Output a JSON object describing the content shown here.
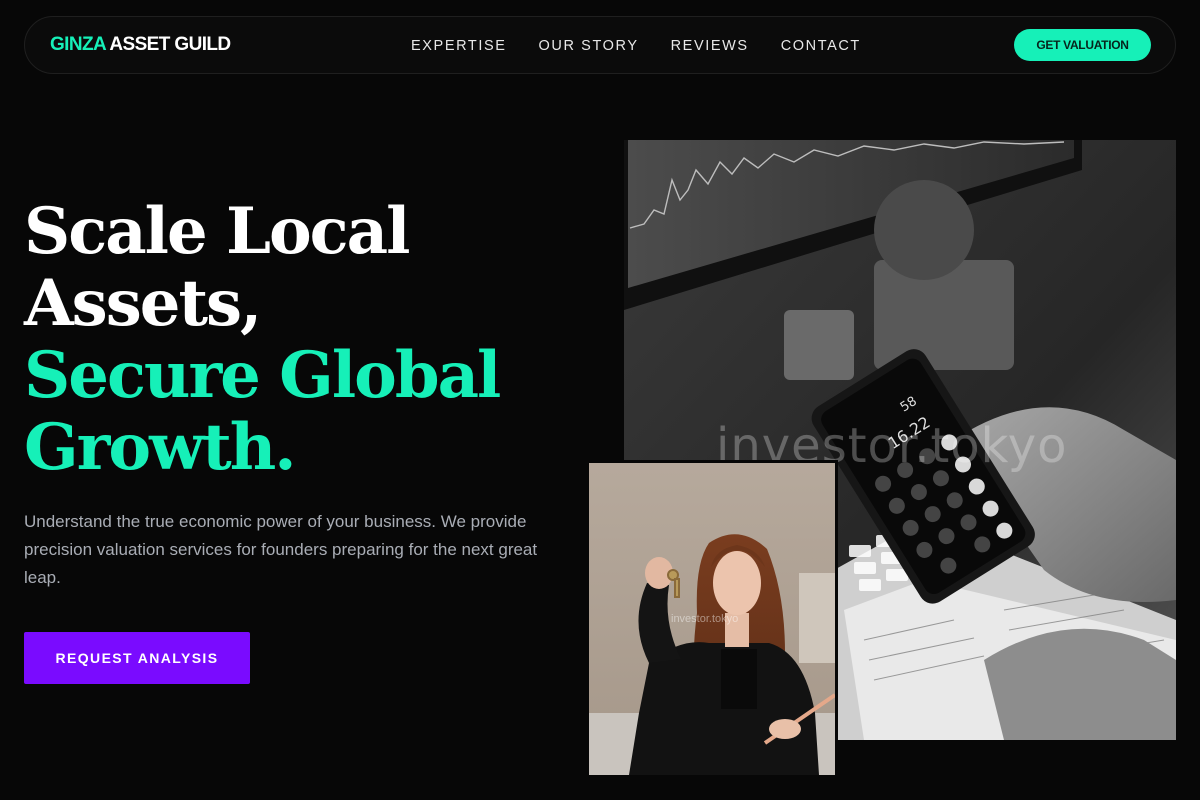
{
  "nav": {
    "logo_accent": "GINZA",
    "logo_rest": " ASSET GUILD",
    "links": [
      "EXPERTISE",
      "OUR STORY",
      "REVIEWS",
      "CONTACT"
    ],
    "cta": "GET VALUATION"
  },
  "hero": {
    "line1": "Scale Local",
    "line2": "Assets,",
    "line3": "Secure Global",
    "line4": "Growth.",
    "lead": "Understand the true economic power of your business. We provide precision valuation services for founders preparing for the next great leap.",
    "cta": "REQUEST ANALYSIS"
  },
  "images": {
    "main_watermark": "investor.tokyo",
    "sub_watermark": "investor.tokyo",
    "calc_display_top": "58",
    "calc_display_main": "16.22"
  },
  "colors": {
    "accent_green": "#16f0b8",
    "accent_purple": "#7a0bff",
    "background": "#070707"
  }
}
